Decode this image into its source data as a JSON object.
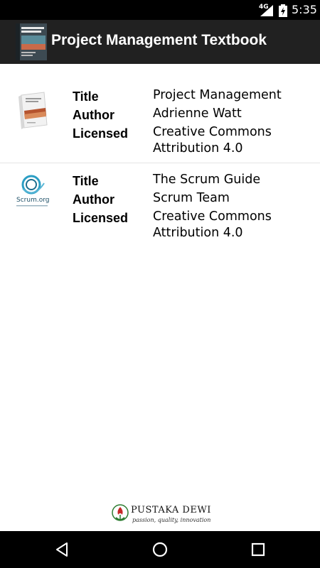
{
  "status_bar": {
    "network": "4G",
    "time": "5:35",
    "icons": [
      "signal-icon",
      "battery-charging-icon"
    ]
  },
  "app_bar": {
    "title": "Project Management Textbook",
    "icon": "book-cover-icon"
  },
  "books": [
    {
      "thumbnail": "project-management-book-cover",
      "title_label": "Title",
      "title": "Project Management",
      "author_label": "Author",
      "author": "Adrienne Watt",
      "license_label": "Licensed",
      "license": "Creative Commons Attribution 4.0"
    },
    {
      "thumbnail": "scrum-org-logo",
      "logo_text": "Scrum.org",
      "title_label": "Title",
      "title": "The Scrum Guide",
      "author_label": "Author",
      "author": "Scrum Team",
      "license_label": "Licensed",
      "license": "Creative Commons Attribution 4.0"
    }
  ],
  "footer": {
    "brand": "PUSTAKA DEWI",
    "tagline": "passion, quality, innovation"
  },
  "nav_bar": {
    "buttons": [
      "back-icon",
      "home-icon",
      "recents-icon"
    ]
  }
}
